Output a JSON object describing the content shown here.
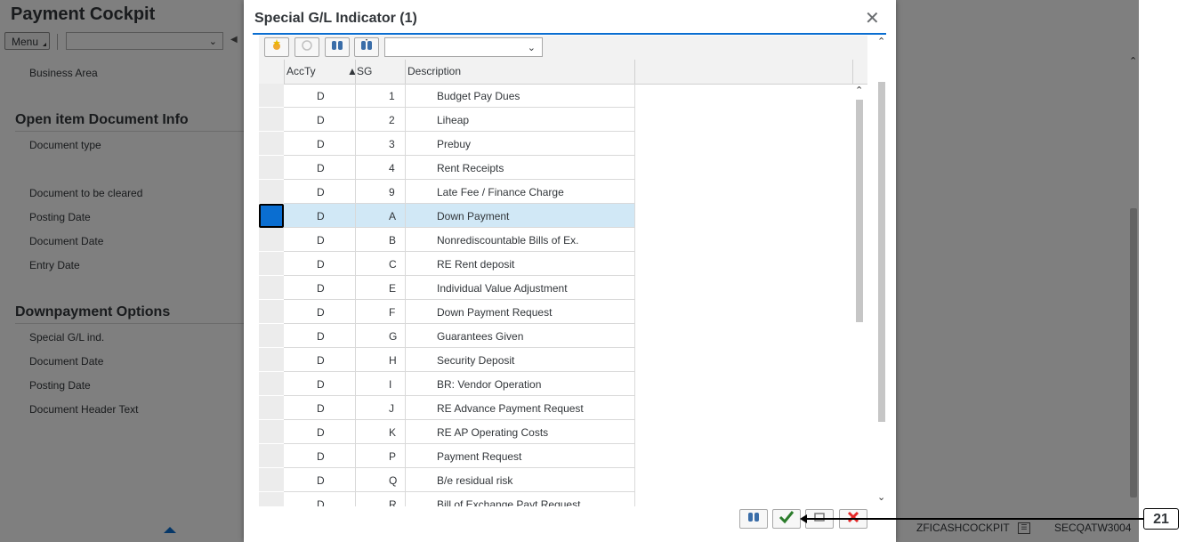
{
  "app": {
    "title": "Payment Cockpit",
    "menu_label": "Menu",
    "form": {
      "business_area": "Business Area",
      "sections": [
        {
          "title": "Open item Document Info",
          "labels": [
            "Document type",
            "Document to be cleared",
            "Posting Date",
            "Document Date",
            "Entry Date"
          ]
        },
        {
          "title": "Downpayment Options",
          "labels": [
            "Special G/L ind.",
            "Document Date",
            "Posting Date",
            "Document Header Text"
          ]
        }
      ]
    },
    "status_bar": {
      "transaction": "ZFICASHCOCKPIT",
      "system": "SECQATW3004"
    }
  },
  "dialog": {
    "title": "Special G/L Indicator (1)",
    "close_icon": "close-icon",
    "toolbar_icons": [
      "select-add-icon",
      "help-icon",
      "find-icon",
      "find-next-icon"
    ],
    "columns": [
      "AccTy",
      "SG",
      "Description"
    ],
    "rows": [
      {
        "accty": "D",
        "sg": "1",
        "desc": "Budget Pay Dues"
      },
      {
        "accty": "D",
        "sg": "2",
        "desc": "Liheap"
      },
      {
        "accty": "D",
        "sg": "3",
        "desc": "Prebuy"
      },
      {
        "accty": "D",
        "sg": "4",
        "desc": "Rent Receipts"
      },
      {
        "accty": "D",
        "sg": "9",
        "desc": "Late Fee / Finance Charge"
      },
      {
        "accty": "D",
        "sg": "A",
        "desc": "Down Payment"
      },
      {
        "accty": "D",
        "sg": "B",
        "desc": "Nonrediscountable Bills of Ex."
      },
      {
        "accty": "D",
        "sg": "C",
        "desc": "RE Rent deposit"
      },
      {
        "accty": "D",
        "sg": "E",
        "desc": "Individual Value Adjustment"
      },
      {
        "accty": "D",
        "sg": "F",
        "desc": "Down Payment Request"
      },
      {
        "accty": "D",
        "sg": "G",
        "desc": "Guarantees Given"
      },
      {
        "accty": "D",
        "sg": "H",
        "desc": "Security Deposit"
      },
      {
        "accty": "D",
        "sg": "I",
        "desc": "BR: Vendor Operation"
      },
      {
        "accty": "D",
        "sg": "J",
        "desc": "RE Advance Payment Request"
      },
      {
        "accty": "D",
        "sg": "K",
        "desc": "RE AP Operating Costs"
      },
      {
        "accty": "D",
        "sg": "P",
        "desc": "Payment Request"
      },
      {
        "accty": "D",
        "sg": "Q",
        "desc": "B/e residual risk"
      },
      {
        "accty": "D",
        "sg": "R",
        "desc": "Bill of Exchange Payt Request"
      }
    ],
    "selected_row_index": 5,
    "footer_icons": [
      "find-icon",
      "confirm-icon",
      "settings-icon",
      "cancel-icon"
    ]
  },
  "annotation": {
    "label": "21"
  },
  "colors": {
    "accent": "#0a6ed1",
    "selected_row": "#d1e8f6",
    "confirm": "#2b7c2b",
    "cancel": "#e52929"
  }
}
